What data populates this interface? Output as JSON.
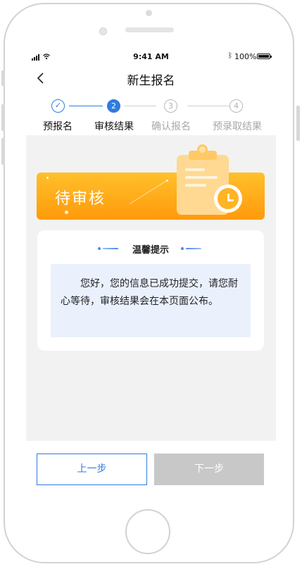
{
  "status_bar": {
    "time": "9:41 AM",
    "battery": "100%"
  },
  "nav": {
    "title": "新生报名"
  },
  "steps": [
    {
      "number": "✓",
      "label": "预报名",
      "state": "done"
    },
    {
      "number": "2",
      "label": "审核结果",
      "state": "active"
    },
    {
      "number": "3",
      "label": "确认报名",
      "state": "todo"
    },
    {
      "number": "4",
      "label": "预录取结果",
      "state": "todo"
    }
  ],
  "banner": {
    "status": "待审核"
  },
  "notice": {
    "title": "温馨提示",
    "message": "您好，您的信息已成功提交，请您耐心等待，审核结果会在本页面公布。"
  },
  "buttons": {
    "prev": "上一步",
    "next": "下一步"
  },
  "colors": {
    "primary": "#2f7be0",
    "banner_top": "#ffc02b",
    "banner_bottom": "#ff9a0b",
    "disabled": "#c8c8c8",
    "notice_bg": "#eaf1fd"
  }
}
